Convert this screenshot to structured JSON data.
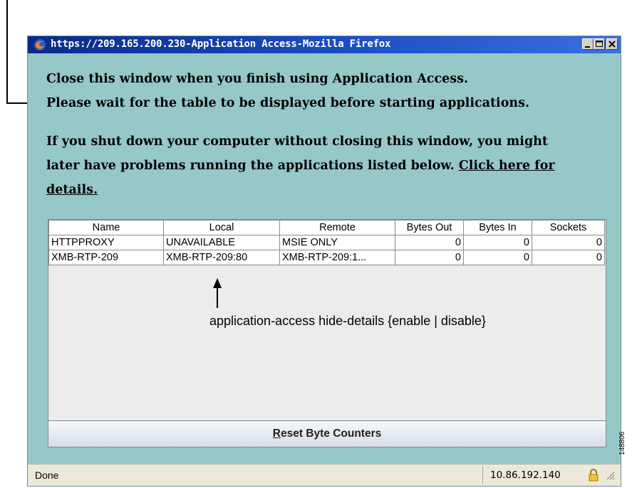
{
  "window": {
    "title": "https://209.165.200.230-Application Access-Mozilla Firefox",
    "title_color": "#1c4fc4",
    "background": "#96c8c8"
  },
  "messages": {
    "line1": "Close this window when you finish using Application Access.",
    "line2": "Please wait for the table to be displayed before starting applications.",
    "line3": "If you shut down your computer without closing this window, you might",
    "line4_text": "later have problems running the applications listed below. ",
    "line4_link": "Click here for",
    "line5_link": "details."
  },
  "table": {
    "columns": [
      "Name",
      "Local",
      "Remote",
      "Bytes Out",
      "Bytes In",
      "Sockets"
    ],
    "rows": [
      [
        "HTTPPROXY",
        "UNAVAILABLE",
        "MSIE ONLY",
        "0",
        "0",
        "0"
      ],
      [
        "XMB-RTP-209",
        "XMB-RTP-209:80",
        "XMB-RTP-209:1...",
        "0",
        "0",
        "0"
      ]
    ]
  },
  "annotation": "application-access hide-details {enable | disable}",
  "reset_button": {
    "underlined": "R",
    "rest": "eset Byte Counters"
  },
  "statusbar": {
    "status": "Done",
    "ip": "10.86.192.140",
    "icons": [
      "lock-icon",
      "resize-grip-icon"
    ]
  },
  "figure_id": "148806"
}
